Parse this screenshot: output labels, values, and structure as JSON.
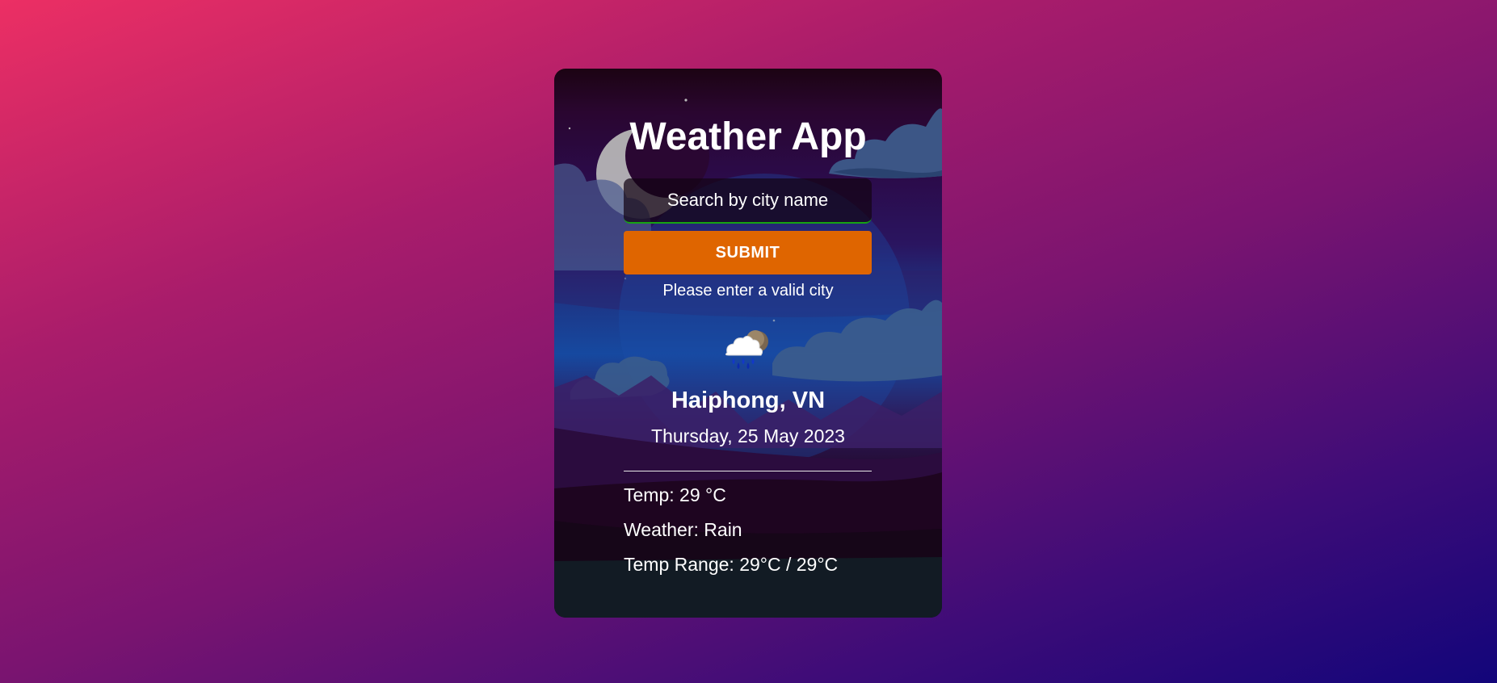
{
  "app": {
    "title": "Weather App"
  },
  "search": {
    "placeholder": "Search by city name"
  },
  "submit": {
    "label": "SUBMIT"
  },
  "message": {
    "error": "Please enter a valid city"
  },
  "weather": {
    "icon": "rain-cloud-moon-icon",
    "location": "Haiphong, VN",
    "date": "Thursday, 25 May 2023",
    "temp": "Temp: 29 °C",
    "condition": "Weather: Rain",
    "range": "Temp Range: 29°C / 29°C"
  },
  "colors": {
    "submit": "#df6500",
    "input_underline": "#17a313",
    "background_start": "#ec2f64",
    "background_end": "#12057a"
  }
}
